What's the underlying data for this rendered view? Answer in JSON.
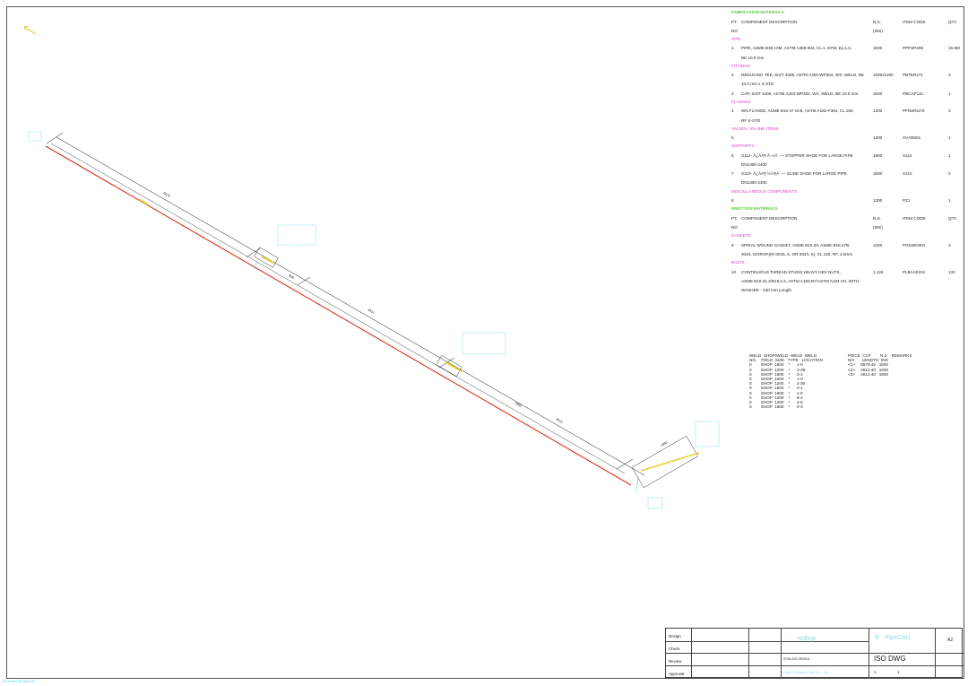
{
  "bom": {
    "fab_title": "FABRICATION MATERIALS",
    "col_pt": "PT.",
    "col_no": "NO",
    "col_desc": "COMPONENT DESCRIPTION",
    "col_ns": "N.S.",
    "col_ins": "(INS)",
    "col_code": "ITEM CODE",
    "col_qty": "QTY",
    "cat_pipe": "PIPE",
    "r1_no": "1",
    "r1_desc": "PIPE, ASME B36.10M, ASTM A358-304, CL.1, EFW, Ej=1.0,",
    "r1_desc2": "BE 10.0 mm",
    "r1_ns": "1600",
    "r1_code": "PPPSP208",
    "r1_qty": "15.9M",
    "cat_fittings": "FITTINGS",
    "r2_no": "2",
    "r2_desc": "REDUCING TEE, SH/T 3408, ASTM A403-WP304, WX, WELD, BE",
    "r2_desc2": "10.0 mm x S-STD",
    "r2_ns": "1600x1200",
    "r2_code": "PBTER271",
    "r2_qty": "3",
    "r3_no": "3",
    "r3_desc": "CAP, SH/T 3408, ASTM A403-WP304, WX, WELD, BE 10.0 mm",
    "r3_ns": "1600",
    "r3_code": "PBCAP131",
    "r3_qty": "1",
    "cat_flanges": "FLANGES",
    "r4_no": "4",
    "r4_desc": "WN FLANGE, ASME B16.47 Sr.B, ASTM A182-F304, CL 150,",
    "r4_desc2": "RF S-STD",
    "r4_ns": "1200",
    "r4_code": "PFNWN176",
    "r4_qty": "3",
    "cat_valves": "VALVES / IN-LINE ITEMS",
    "r5_no": "5",
    "r5_ns": "1200",
    "r5_code": "XV-09301",
    "r5_qty": "1",
    "cat_supports": "SUPPORTS",
    "r6_no": "6",
    "r6_desc": "S112- Ä¿ÂÁ¶ Å¬»Á´ — STOPPER SHOE FOR LARGE PIPE",
    "r6_desc2": "DN1300-2400",
    "r6_ns": "1600",
    "r6_code": "S112",
    "r6_qty": "1",
    "r7_no": "7",
    "r7_desc": "S110- Ä¿ÂÁ¶ ½½¶À´ — SLIDE SHOE FOR LARGE PIPE",
    "r7_desc2": "DN1300-2400",
    "r7_ns": "1600",
    "r7_code": "S110",
    "r7_qty": "2",
    "cat_misc": "MISCELLANEOUS COMPONENTS",
    "r8_no": "8",
    "r8_ns": "1200",
    "r8_code": "PZJ",
    "r8_qty": "1",
    "erec_title": "ERECTION MATERIALS",
    "cat_gaskets": "GASKETS",
    "r9_no": "9",
    "r9_desc": "SPIRAL WOUND GASKET, ASME B16.20, ASME B16.47B,",
    "r9_desc2": "304/L S/GRAP.(IR-304/L S, OR-304/L S), CL 150, RF, 4.5mm",
    "r9_ns": "1200",
    "r9_code": "PGSWG001",
    "r9_qty": "3",
    "cat_bolts": "BOLTS",
    "r10_no": "10",
    "r10_desc": "CONTINUOUS THREAD STUD/2 HEAVY HEX NUTS,",
    "r10_desc2": "ASME B18.31.2/B18.2.2, ASTM A193-B7/ASTM A194-2H, WITH",
    "r10_desc3": "WASHER - 230 mm Length",
    "r10_ns": "1.125",
    "r10_code": "PLBAA0102",
    "r10_qty": "132"
  },
  "weld_table": {
    "header": "WELD  SHOP/WELD  WELD  WELD\nNO.    FIELD  SIZE   TYPE   LOCATION",
    "rows": "0        SHOP  1600    *      1-0\n0        SHOP  1200    *      2-28\n0        SHOP  1600    *      0-1\n0        SHOP  1600    *      1-0\n0        SHOP  1200    *      2-30\n0        SHOP  1600    *      0-1\n0        SHOP  1600    *      1-0\n0        SHOP  1200    *      8-4\n0        SHOP  1200    *      4-8\n0        SHOP  1600    *      0-3"
  },
  "cut_table": {
    "header": "PIECE  CUT        N.S    REMARKS\nNO       LENGTH  INS",
    "rows": "<1>     6579.45   1600\n<2>     4612.40   1600\n<3>     4612.40   1600"
  },
  "iso_labels": {
    "dim1": "6579",
    "dim2": "4612",
    "dim3": "4612",
    "dim4": "1950",
    "dim5": "800",
    "dim6": "2390"
  },
  "title_block": {
    "design": "Design",
    "check": "Check",
    "review": "Review",
    "approval": "Approval",
    "brand1": "redbge",
    "brand2": "PipeCAD",
    "size": "A2",
    "drawing_no": "3708-DG-0F0001",
    "title": "ISO DWG",
    "company": "Hubei Redbge CAD Co., Ltd.",
    "sheet": "1",
    "of": "1"
  },
  "footer": "Generated By PipeCAD",
  "colors": {
    "pipe": "#d7321f",
    "dim": "#111111",
    "tag": "#45c6e0",
    "fab": "#56c93a",
    "cat": "#d641c9",
    "flange": "#e8d23a"
  }
}
